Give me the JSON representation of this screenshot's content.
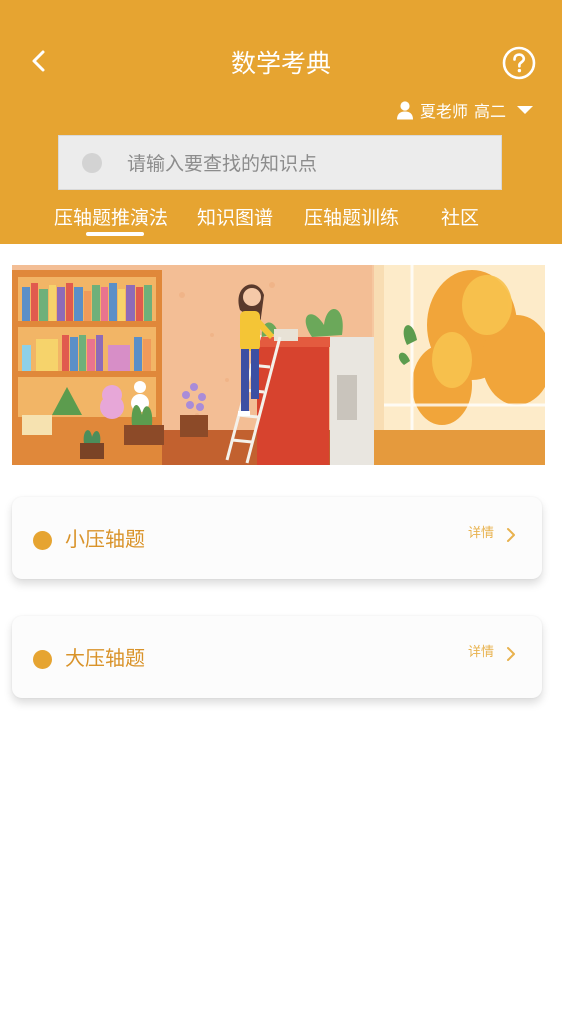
{
  "header": {
    "title": "数学考典",
    "back_icon": "chevron-left-icon",
    "help_icon": "question-circle-icon",
    "user": {
      "name": "夏老师",
      "grade": "高二",
      "icon": "person-icon",
      "dropdown_icon": "caret-down-icon"
    }
  },
  "search": {
    "placeholder": "请输入要查找的知识点",
    "icon": "search-icon"
  },
  "tabs": [
    {
      "label": "压轴题推演法",
      "active": true
    },
    {
      "label": "知识图谱"
    },
    {
      "label": "压轴题训练"
    },
    {
      "label": "社区"
    }
  ],
  "banner": {
    "icon": "illustration-girl-bookshelf"
  },
  "cards": [
    {
      "label": "小压轴题",
      "detail": "详情",
      "chevron_icon": "chevron-right-icon"
    },
    {
      "label": "大压轴题",
      "detail": "详情",
      "chevron_icon": "chevron-right-icon"
    }
  ],
  "colors": {
    "accent": "#E6A431",
    "card_text": "#D9932A",
    "detail_text": "#E8B24E"
  }
}
